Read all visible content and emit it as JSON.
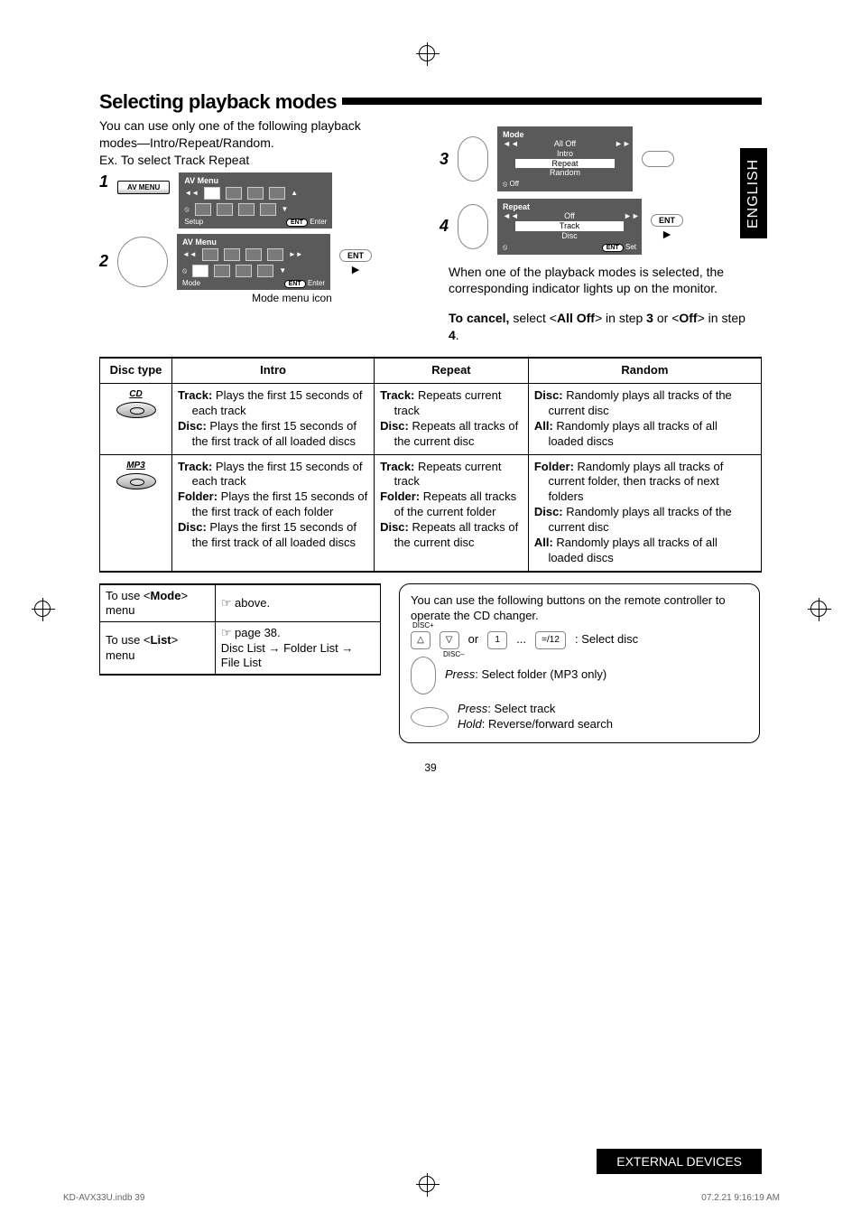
{
  "title": "Selecting playback modes",
  "intro_line1": "You can use only one of the following playback modes—Intro/Repeat/Random.",
  "intro_line2": "Ex. To select Track Repeat",
  "language_tab": "ENGLISH",
  "steps": {
    "s1": "1",
    "s2": "2",
    "s3": "3",
    "s4": "4",
    "av_menu_btn": "AV MENU",
    "av_menu_title": "AV Menu",
    "foot_setup": "Setup",
    "foot_mode": "Mode",
    "foot_ent": "ENT",
    "foot_enter": "Enter",
    "mode_caption": "Mode menu icon",
    "ent_btn": "ENT",
    "mode_panel": {
      "title": "Mode",
      "items": [
        "All Off",
        "Intro",
        "Repeat",
        "Random"
      ],
      "selected": "Repeat",
      "bottom": "Off"
    },
    "repeat_panel": {
      "title": "Repeat",
      "items": [
        "Off",
        "Track",
        "Disc"
      ],
      "selected": "Track",
      "bottom_ent": "ENT",
      "bottom_set": "Set"
    }
  },
  "note_after": "When one of the playback modes is selected, the corresponding indicator lights up on the monitor.",
  "cancel": {
    "lead": "To cancel,",
    "part1": " select <",
    "alloff": "All Off",
    "part2": "> in step ",
    "s3": "3",
    "part3": " or <",
    "off": "Off",
    "part4": "> in step ",
    "s4": "4",
    "part5": "."
  },
  "table": {
    "head": [
      "Disc type",
      "Intro",
      "Repeat",
      "Random"
    ],
    "row1": {
      "disc": "CD",
      "intro": [
        {
          "b": "Track:",
          "t": " Plays the first 15 seconds of each track"
        },
        {
          "b": "Disc:",
          "t": " Plays the first 15 seconds of the first track of all loaded discs"
        }
      ],
      "repeat": [
        {
          "b": "Track:",
          "t": " Repeats current track"
        },
        {
          "b": "Disc:",
          "t": " Repeats all tracks of the current disc"
        }
      ],
      "random": [
        {
          "b": "Disc:",
          "t": " Randomly plays all tracks of the current disc"
        },
        {
          "b": "All:",
          "t": " Randomly plays all tracks of all loaded discs"
        }
      ]
    },
    "row2": {
      "disc": "MP3",
      "intro": [
        {
          "b": "Track:",
          "t": " Plays the first 15 seconds of each track"
        },
        {
          "b": "Folder:",
          "t": " Plays the first 15 seconds of the first track of each folder"
        },
        {
          "b": "Disc:",
          "t": " Plays the first 15 seconds of the first track of all loaded discs"
        }
      ],
      "repeat": [
        {
          "b": "Track:",
          "t": " Repeats current track"
        },
        {
          "b": "Folder:",
          "t": " Repeats all tracks of the current folder"
        },
        {
          "b": "Disc:",
          "t": " Repeats all tracks of the current disc"
        }
      ],
      "random": [
        {
          "b": "Folder:",
          "t": " Randomly plays all tracks of current folder, then tracks of next folders"
        },
        {
          "b": "Disc:",
          "t": " Randomly plays all tracks of the current disc"
        },
        {
          "b": "All:",
          "t": " Randomly plays all tracks of all loaded discs"
        }
      ]
    }
  },
  "small_table": {
    "r1_left": "To use <Mode> menu",
    "r1_right": "☞ above.",
    "r2_left": "To use <List> menu",
    "r2_right": "☞ page 38.\nDisc List → Folder List → File List"
  },
  "remote": {
    "lead": "You can use the following buttons on the remote controller to operate the CD changer.",
    "disc_plus": "DISC+",
    "disc_minus": "DISC–",
    "or": "or",
    "one": "1",
    "dots": "...",
    "twelve": "=/12",
    "select_disc": " : Select disc",
    "press1": "Press",
    "folder": ": Select folder (MP3 only)",
    "press2": "Press",
    "track": ": Select track",
    "hold": "Hold",
    "rev": ": Reverse/forward search"
  },
  "page_num": "39",
  "footer_tab": "EXTERNAL DEVICES",
  "crumb_left": "KD-AVX33U.indb   39",
  "crumb_right": "07.2.21   9:16:19 AM"
}
